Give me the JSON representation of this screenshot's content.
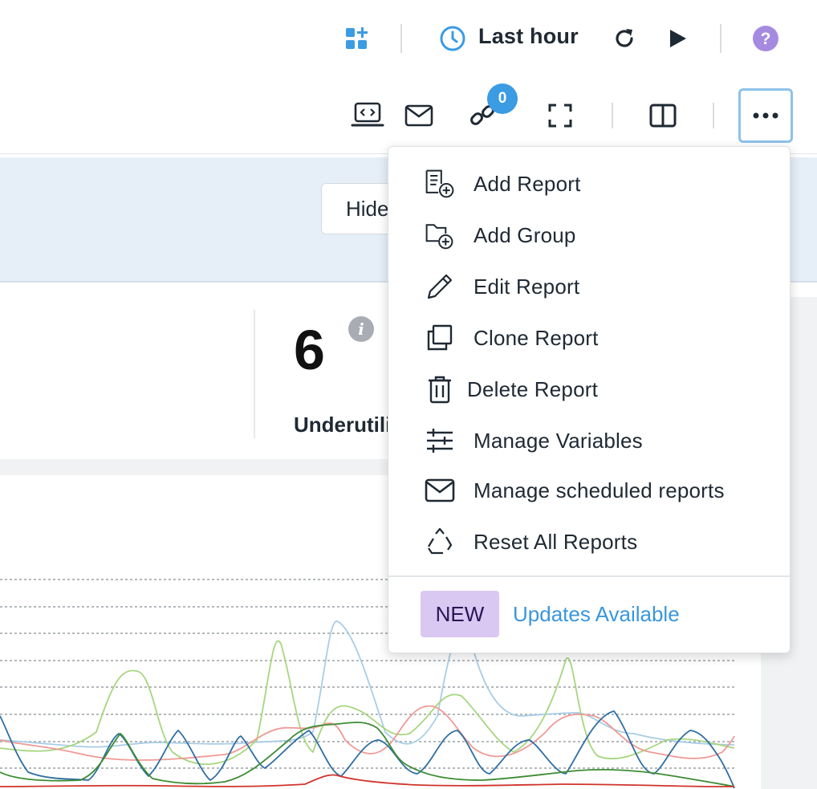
{
  "header": {
    "time_range_label": "Last hour",
    "icons": [
      "add-panel-icon",
      "clock-icon",
      "refresh-icon",
      "play-icon",
      "help-icon"
    ]
  },
  "toolbar": {
    "icons": [
      "embed-code-icon",
      "email-icon",
      "share-link-icon",
      "fullscreen-icon",
      "split-view-icon",
      "more-options-icon"
    ],
    "link_count": "0"
  },
  "banner": {
    "hide_button_label": "Hide"
  },
  "stats": {
    "value": "6",
    "label": "Underutilized"
  },
  "menu": {
    "items": [
      {
        "label": "Add Report",
        "icon": "add-report-icon"
      },
      {
        "label": "Add Group",
        "icon": "add-group-icon"
      },
      {
        "label": "Edit Report",
        "icon": "pencil-icon"
      },
      {
        "label": "Clone Report",
        "icon": "clone-icon"
      },
      {
        "label": "Delete Report",
        "icon": "trash-icon"
      },
      {
        "label": "Manage Variables",
        "icon": "sliders-icon"
      },
      {
        "label": "Manage scheduled reports",
        "icon": "envelope-icon"
      },
      {
        "label": "Reset All Reports",
        "icon": "recycle-icon"
      }
    ],
    "new_badge": "NEW",
    "updates_link": "Updates Available"
  },
  "colors": {
    "accent": "#3a96dd",
    "focus_border": "#8cc2ea",
    "new_badge_bg": "#d9c8f2",
    "help_icon": "#a58be0",
    "series": [
      "#a8cde6",
      "#a7d67f",
      "#ef9a95",
      "#2f6ea3",
      "#3d8c33",
      "#d0342c"
    ]
  }
}
